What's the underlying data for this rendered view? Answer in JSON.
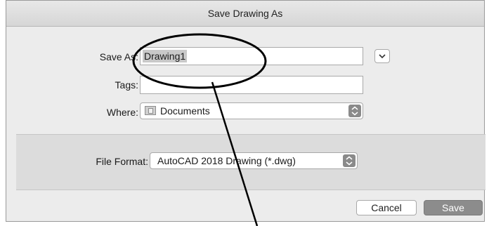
{
  "dialog": {
    "title": "Save Drawing As"
  },
  "form": {
    "save_as_label": "Save As:",
    "save_as_value": "Drawing1",
    "tags_label": "Tags:",
    "tags_value": "",
    "where_label": "Where:",
    "where_value": "Documents",
    "file_format_label": "File Format:",
    "file_format_value": "AutoCAD 2018 Drawing (*.dwg)"
  },
  "buttons": {
    "cancel_label": "Cancel",
    "save_label": "Save"
  },
  "icons": {
    "expand": "chevron-down-icon",
    "where_stepper": "chevron-up-down-icon",
    "format_stepper": "chevron-up-down-icon",
    "folder": "folder-icon"
  }
}
